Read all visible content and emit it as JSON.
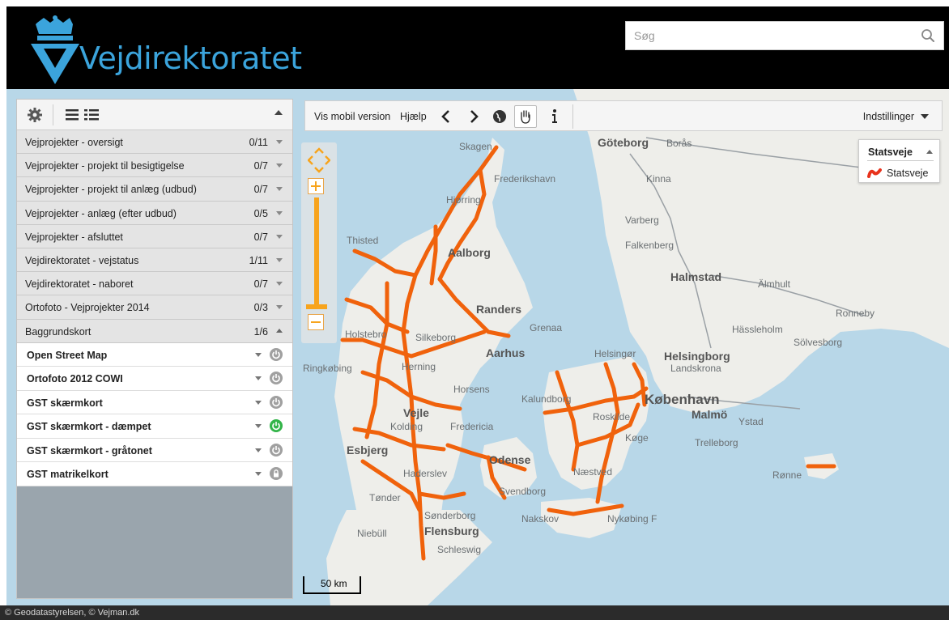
{
  "header": {
    "brand_name": "Vejdirektoratet",
    "search_placeholder": "Søg",
    "colors": {
      "header_bg": "#000000",
      "brand": "#3ba4dc"
    }
  },
  "layer_panel": {
    "toolbar_icons": [
      "gear-icon",
      "list-view-icon",
      "detail-list-view-icon"
    ],
    "groups": [
      {
        "label": "Vejprojekter - oversigt",
        "count": "0/11"
      },
      {
        "label": "Vejprojekter - projekt til besigtigelse",
        "count": "0/7"
      },
      {
        "label": "Vejprojekter - projekt til anlæg (udbud)",
        "count": "0/7"
      },
      {
        "label": "Vejprojekter - anlæg (efter udbud)",
        "count": "0/5"
      },
      {
        "label": "Vejprojekter - afsluttet",
        "count": "0/7"
      },
      {
        "label": "Vejdirektoratet - vejstatus",
        "count": "1/11"
      },
      {
        "label": "Vejdirektoratet - naboret",
        "count": "0/7"
      },
      {
        "label": "Ortofoto - Vejprojekter 2014",
        "count": "0/3"
      },
      {
        "label": "Baggrundskort",
        "count": "1/6",
        "expanded": true
      }
    ],
    "base_layers": [
      {
        "label": "Open Street Map",
        "active": false,
        "locked": false
      },
      {
        "label": "Ortofoto 2012 COWI",
        "active": false,
        "locked": false
      },
      {
        "label": "GST skærmkort",
        "active": false,
        "locked": false
      },
      {
        "label": "GST skærmkort - dæmpet",
        "active": true,
        "locked": false
      },
      {
        "label": "GST skærmkort - gråtonet",
        "active": false,
        "locked": false
      },
      {
        "label": "GST matrikelkort",
        "active": false,
        "locked": true
      }
    ]
  },
  "map_toolbar": {
    "mobile_label": "Vis mobil version",
    "help_label": "Hjælp",
    "settings_label": "Indstillinger",
    "icons": [
      "back-icon",
      "forward-icon",
      "globe-icon",
      "pan-hand-icon",
      "info-icon"
    ]
  },
  "legend": {
    "title": "Statsveje",
    "item_label": "Statsveje",
    "road_color": "#f0620c"
  },
  "map": {
    "scale_label": "50 km",
    "labels": {
      "skagen": "Skagen",
      "frederikshavn": "Frederikshavn",
      "hjorring": "Hjørring",
      "goteborg": "Göteborg",
      "boras": "Borås",
      "kinna": "Kinna",
      "varberg": "Varberg",
      "falkenberg": "Falkenberg",
      "halmstad": "Halmstad",
      "almhult": "Älmhult",
      "ronneby": "Ronneby",
      "hassleholm": "Hässleholm",
      "solvesborg": "Sölvesborg",
      "thisted": "Thisted",
      "aalborg": "Aalborg",
      "randers": "Randers",
      "grenaa": "Grenaa",
      "holstebro": "Holstebro",
      "silkeborg": "Silkeborg",
      "aarhus": "Aarhus",
      "ringkobing": "Ringkøbing",
      "herning": "Herning",
      "horsens": "Horsens",
      "vejle": "Vejle",
      "kolding": "Kolding",
      "fredericia": "Fredericia",
      "esbjerg": "Esbjerg",
      "odense": "Odense",
      "haderslev": "Haderslev",
      "svendborg": "Svendborg",
      "tonder": "Tønder",
      "sonderborg": "Sønderborg",
      "niebull": "Niebüll",
      "flensburg": "Flensburg",
      "schleswig": "Schleswig",
      "nakskov": "Nakskov",
      "nykobing": "Nykøbing F",
      "naestved": "Næstved",
      "koge": "Køge",
      "roskilde": "Roskilde",
      "kalundborg": "Kalundborg",
      "helsingor": "Helsingør",
      "helsingborg": "Helsingborg",
      "landskrona": "Landskrona",
      "kobenhavn": "København",
      "malmo": "Malmö",
      "ystad": "Ystad",
      "trelleborg": "Trelleborg",
      "ronne": "Rønne"
    }
  },
  "footer": {
    "copyright": "© Geodatastyrelsen, © Vejman.dk"
  }
}
